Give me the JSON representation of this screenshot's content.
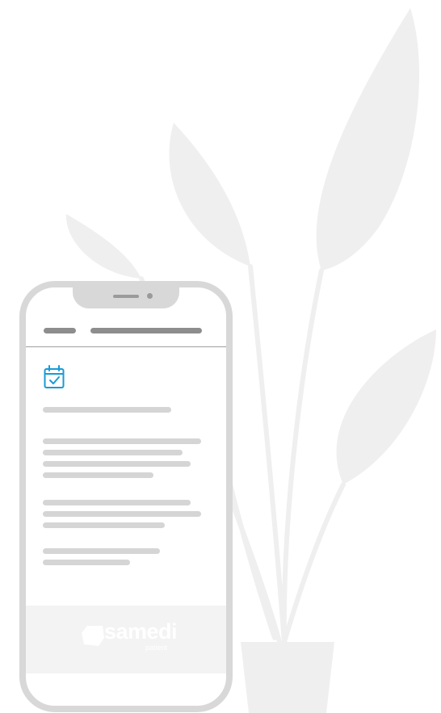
{
  "brand": {
    "name": "samedi",
    "subtitle": "patient"
  },
  "icons": {
    "appointment": "calendar-check-icon",
    "logo": "samedi-logo-icon"
  },
  "colors": {
    "accent": "#1a9ad6",
    "phone_frame": "#d8d8d8",
    "plant": "#efefef",
    "placeholder": "#d5d5d5",
    "header_placeholder": "#8d8d8d"
  }
}
